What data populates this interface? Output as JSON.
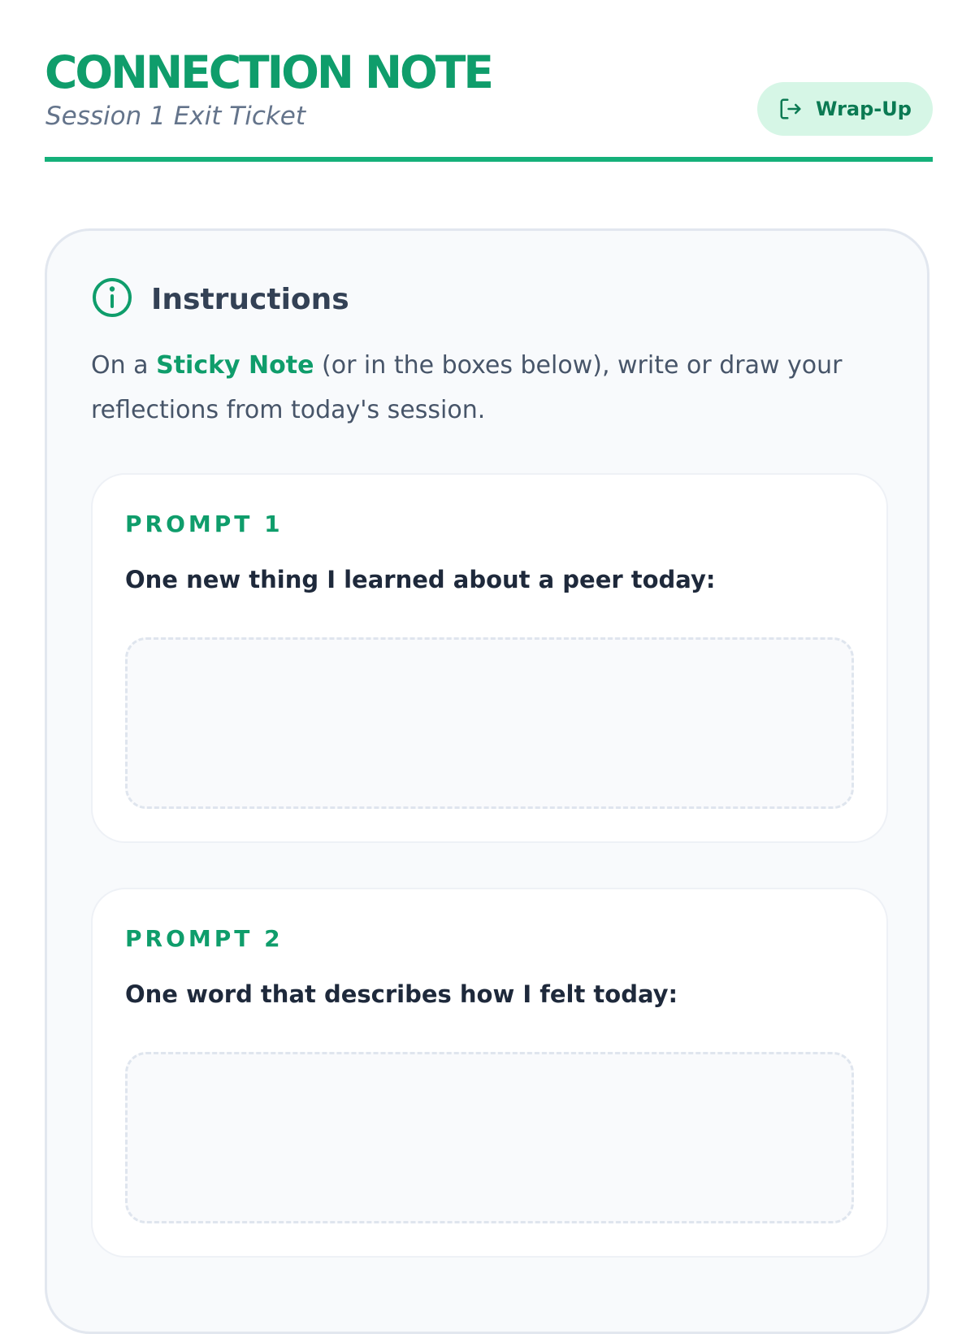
{
  "header": {
    "title": "CONNECTION NOTE",
    "subtitle": "Session 1 Exit Ticket",
    "wrap_up_button": {
      "label": "Wrap-Up",
      "icon": "exit-icon"
    }
  },
  "colors": {
    "accent": "#0f9d6b",
    "accent_light": "#d6f6e6",
    "rule": "#15b07a",
    "card_bg": "#f8fafc"
  },
  "instructions": {
    "icon": "info-icon",
    "title": "Instructions",
    "text_before": "On a ",
    "highlight": "Sticky Note",
    "text_after": " (or in the boxes below), write or draw your reflections from today's session."
  },
  "prompts": [
    {
      "label": "PROMPT 1",
      "question": "One new thing I learned about a peer today:",
      "answer": ""
    },
    {
      "label": "PROMPT 2",
      "question": "One word that describes how I felt today:",
      "answer": ""
    }
  ]
}
